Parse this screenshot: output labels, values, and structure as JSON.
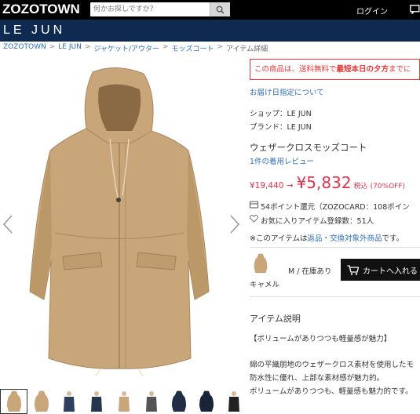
{
  "header": {
    "logo": "ZOZOTOWN",
    "search_placeholder": "何かお探しですか？",
    "login": "ログイン"
  },
  "brand_bar": {
    "name": "LE JUN"
  },
  "breadcrumb": [
    "ZOZOTOWN",
    "LE JUN",
    "ジャケット/アウター",
    "モッズコート",
    "アイテム詳細"
  ],
  "notice": {
    "prefix": "この商品は、送料無料で",
    "bold": "最短本日の夕方",
    "suffix": "までに"
  },
  "delivery_link": "お届け日指定について",
  "shop": "ショップ：LE JUN",
  "brand": "ブランド：LE JUN",
  "product": {
    "title": "ウェザークロスモッズコート",
    "review_link": "1件の着用レビュー",
    "price_old": "¥19,440 →",
    "price_new": "¥5,832",
    "tax": "税込",
    "discount": "(70%OFF)",
    "points": "54ポイント還元（ZOZOCARD：108ポイン",
    "favorites": "お気に入りアイテム登録数：51人",
    "return_prefix": "※このアイテムは",
    "return_link": "返品・交換対象外商品",
    "return_suffix": "です。"
  },
  "variant": {
    "size_stock": "M / 在庫あり",
    "color": "キャメル",
    "cart_button": "カートへ入れる"
  },
  "description": {
    "heading": "アイテム説明",
    "line1": "【ボリュームがありつつも軽量感が魅力】",
    "line2": "綿の平織朋地のウェザークロス素材を使用したモ",
    "line3": "防水性に優れ、上部な素材感が魅力的。",
    "line4": "ボリュームがありつつも、軽量感も魅力的です。"
  },
  "colors": {
    "topbar": "#000000",
    "brandbar": "#0f2a50",
    "accent_red": "#e0324b",
    "link_blue": "#2b6fbf",
    "coat": "#c9a67a"
  },
  "icons": [
    "search-icon",
    "message-icon",
    "chevron-left-icon",
    "chevron-right-icon",
    "truck-icon",
    "heart-icon",
    "cart-icon"
  ]
}
